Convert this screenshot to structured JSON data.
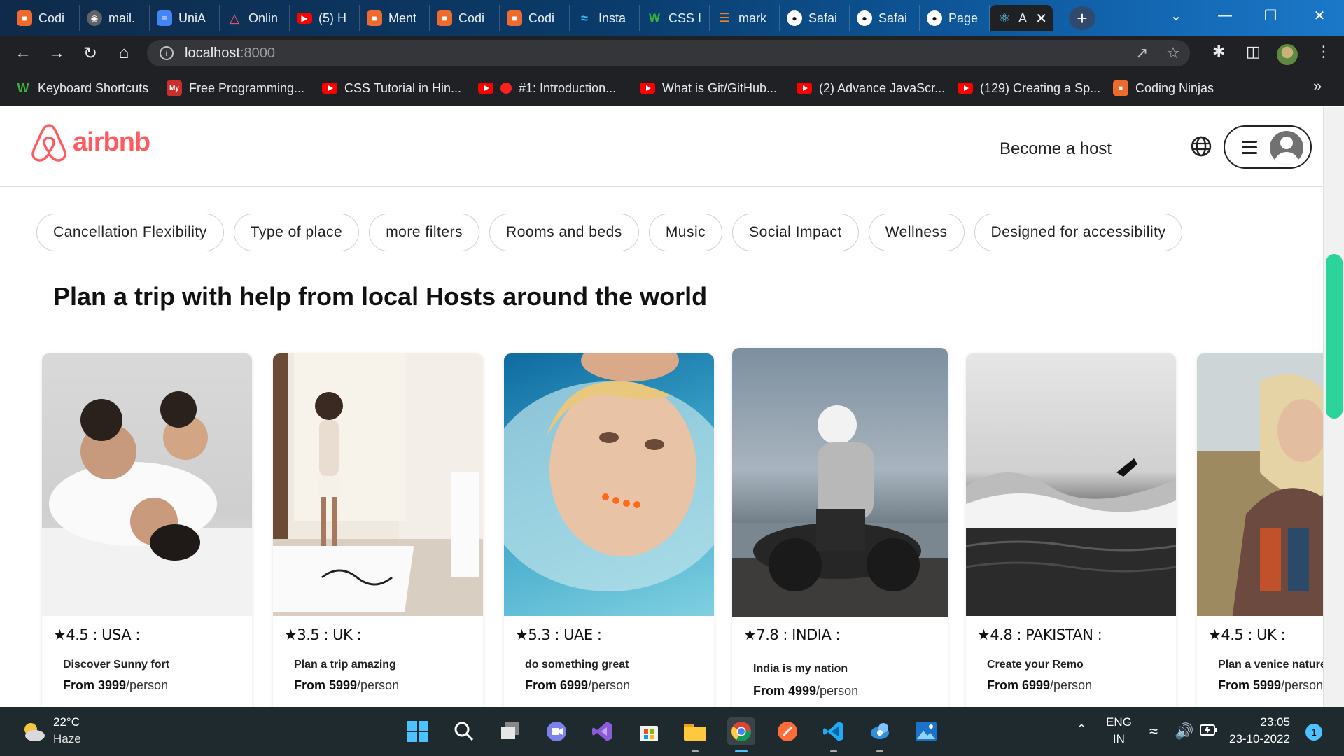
{
  "browser": {
    "tabs": [
      {
        "label": "Codi",
        "icon": "coding-ninjas-icon",
        "color": "#ef6a2d"
      },
      {
        "label": "mail.",
        "icon": "globe-icon",
        "color": "#5f6368"
      },
      {
        "label": "UniA",
        "icon": "document-icon",
        "color": "#4285f4"
      },
      {
        "label": "Onlin",
        "icon": "airbnb-icon",
        "color": "#ff5a60"
      },
      {
        "label": "(5) H",
        "icon": "youtube-icon",
        "color": "#ff0000"
      },
      {
        "label": "Ment",
        "icon": "coding-ninjas-icon",
        "color": "#ef6a2d"
      },
      {
        "label": "Codi",
        "icon": "coding-ninjas-icon",
        "color": "#ef6a2d"
      },
      {
        "label": "Codi",
        "icon": "coding-ninjas-icon",
        "color": "#ef6a2d"
      },
      {
        "label": "Insta",
        "icon": "tailwind-icon",
        "color": "#38bdf8"
      },
      {
        "label": "CSS I",
        "icon": "w3schools-icon",
        "color": "#3cb23c"
      },
      {
        "label": "mark",
        "icon": "stackoverflow-icon",
        "color": "#f48024"
      },
      {
        "label": "Safai",
        "icon": "github-icon",
        "color": "#ffffff"
      },
      {
        "label": "Safai",
        "icon": "github-icon",
        "color": "#ffffff"
      },
      {
        "label": "Page",
        "icon": "github-icon",
        "color": "#ffffff"
      },
      {
        "label": "A",
        "icon": "react-icon",
        "color": "#61dafb",
        "active": true
      }
    ],
    "url_host": "localhost",
    "url_port": ":8000",
    "bookmarks": [
      {
        "label": "Keyboard Shortcuts",
        "icon": "w3schools"
      },
      {
        "label": "Free Programming...",
        "icon": "my"
      },
      {
        "label": "CSS Tutorial in Hin...",
        "icon": "youtube"
      },
      {
        "label": "#1: Introduction...",
        "icon": "youtube-dot"
      },
      {
        "label": "What is Git/GitHub...",
        "icon": "youtube"
      },
      {
        "label": "(2) Advance JavaScr...",
        "icon": "youtube"
      },
      {
        "label": "(129) Creating a Sp...",
        "icon": "youtube"
      },
      {
        "label": "Coding Ninjas",
        "icon": "coding-ninjas"
      }
    ]
  },
  "page": {
    "logo_text": "airbnb",
    "brand_color": "#ff5a60",
    "become_host": "Become a host",
    "filters": [
      "Cancellation Flexibility",
      "Type of place",
      "more filters",
      "Rooms and beds",
      "Music",
      "Social Impact",
      "Wellness",
      "Designed for accessibility"
    ],
    "headline": "Plan a trip with help from local Hosts around the world",
    "cards": [
      {
        "rating": "4.5",
        "country": "USA",
        "title": "Discover Sunny fort",
        "price": "From 3999",
        "per": "/person"
      },
      {
        "rating": "3.5",
        "country": "UK",
        "title": "Plan a trip amazing",
        "price": "From 5999",
        "per": "/person"
      },
      {
        "rating": "5.3",
        "country": "UAE",
        "title": "do something great",
        "price": "From 6999",
        "per": "/person"
      },
      {
        "rating": "7.8",
        "country": "INDIA",
        "title": "India is my nation",
        "price": "From 4999",
        "per": "/person"
      },
      {
        "rating": "4.8",
        "country": "PAKISTAN",
        "title": "Create your Remo",
        "price": "From 6999",
        "per": "/person"
      },
      {
        "rating": "4.5",
        "country": "UK",
        "title": "Plan a venice nature",
        "price": "From 5999",
        "per": "/person"
      }
    ]
  },
  "taskbar": {
    "temperature": "22°C",
    "weather": "Haze",
    "lang_top": "ENG",
    "lang_bottom": "IN",
    "time": "23:05",
    "date": "23-10-2022",
    "notifications": "1"
  }
}
